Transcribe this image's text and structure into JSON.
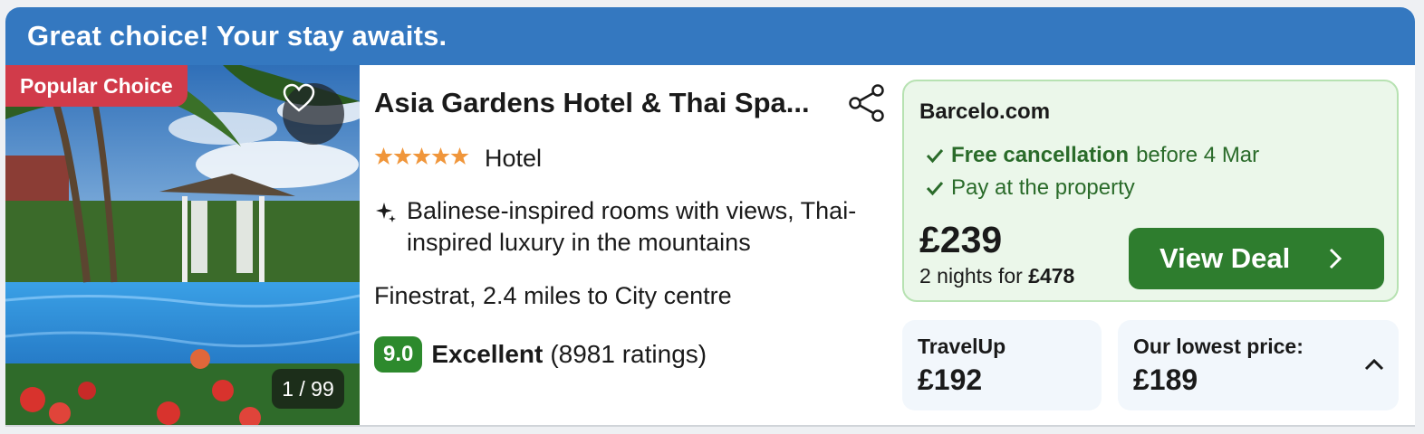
{
  "banner": {
    "text": "Great choice! Your stay awaits."
  },
  "photo": {
    "badge": "Popular Choice",
    "counter": "1 / 99",
    "favorite_icon": "heart-icon"
  },
  "hotel": {
    "name": "Asia Gardens Hotel & Thai Spa...",
    "stars": 5,
    "type": "Hotel",
    "highlight": "Balinese-inspired rooms with views, Thai-inspired luxury in the mountains",
    "location": "Finestrat, 2.4 miles to City centre",
    "score": "9.0",
    "rating_word": "Excellent",
    "rating_count": "(8981 ratings)",
    "share_icon": "share-icon"
  },
  "deal": {
    "provider": "Barcelo.com",
    "perks": [
      {
        "strong": "Free cancellation",
        "rest": "before 4 Mar"
      },
      {
        "strong": "",
        "rest": "Pay at the property"
      }
    ],
    "price": "£239",
    "nights_prefix": "2 nights for",
    "nights_total": "£478",
    "cta": "View Deal"
  },
  "alternatives": [
    {
      "name": "TravelUp",
      "price": "£192"
    },
    {
      "name": "Our lowest price:",
      "price": "£189"
    }
  ],
  "colors": {
    "banner": "#3478c0",
    "popular_badge": "#d13b4a",
    "score_badge": "#2d8a2d",
    "cta": "#2e7d2e",
    "deal_bg": "#ebf7ea",
    "star": "#f0963b"
  }
}
